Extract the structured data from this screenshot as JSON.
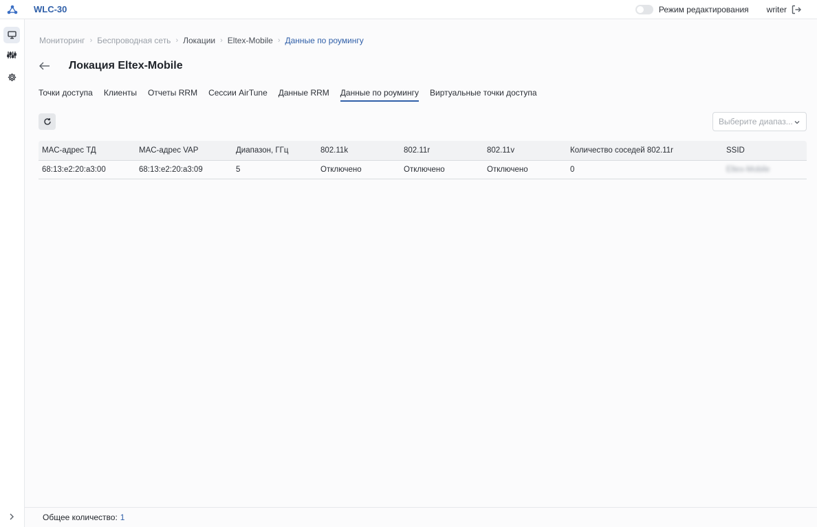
{
  "header": {
    "app_title": "WLC-30",
    "logo_icon": "network-nodes-icon",
    "edit_mode_label": "Режим редактирования",
    "edit_mode_on": false,
    "username": "writer",
    "logout_icon": "logout-icon"
  },
  "sidebar": {
    "items": [
      {
        "icon": "monitor-icon",
        "active": true
      },
      {
        "icon": "sliders-icon",
        "active": false
      },
      {
        "icon": "gear-icon",
        "active": false
      }
    ],
    "expand_icon": "chevron-right-icon"
  },
  "breadcrumb": [
    "Мониторинг",
    "Беспроводная сеть",
    "Локации",
    "Eltex-Mobile",
    "Данные по роумингу"
  ],
  "page_title": "Локация Eltex-Mobile",
  "tabs": [
    {
      "label": "Точки доступа",
      "active": false
    },
    {
      "label": "Клиенты",
      "active": false
    },
    {
      "label": "Отчеты RRM",
      "active": false
    },
    {
      "label": "Сессии AirTune",
      "active": false
    },
    {
      "label": "Данные RRM",
      "active": false
    },
    {
      "label": "Данные по роумингу",
      "active": true
    },
    {
      "label": "Виртуальные точки доступа",
      "active": false
    }
  ],
  "toolbar": {
    "refresh_icon": "refresh-icon",
    "range_placeholder": "Выберите диапаз..."
  },
  "table": {
    "columns": [
      "MAC-адрес ТД",
      "MAC-адрес VAP",
      "Диапазон, ГГц",
      "802.11k",
      "802.11r",
      "802.11v",
      "Количество соседей 802.11r",
      "SSID"
    ],
    "rows": [
      [
        "68:13:e2:20:a3:00",
        "68:13:e2:20:a3:09",
        "5",
        "Отключено",
        "Отключено",
        "Отключено",
        "0",
        "Eltex-Mobile"
      ]
    ]
  },
  "footer": {
    "total_label": "Общее количество:",
    "total_value": "1"
  },
  "colors": {
    "accent": "#2f5fa8",
    "active_tab_underline": "#2f5fa8"
  }
}
